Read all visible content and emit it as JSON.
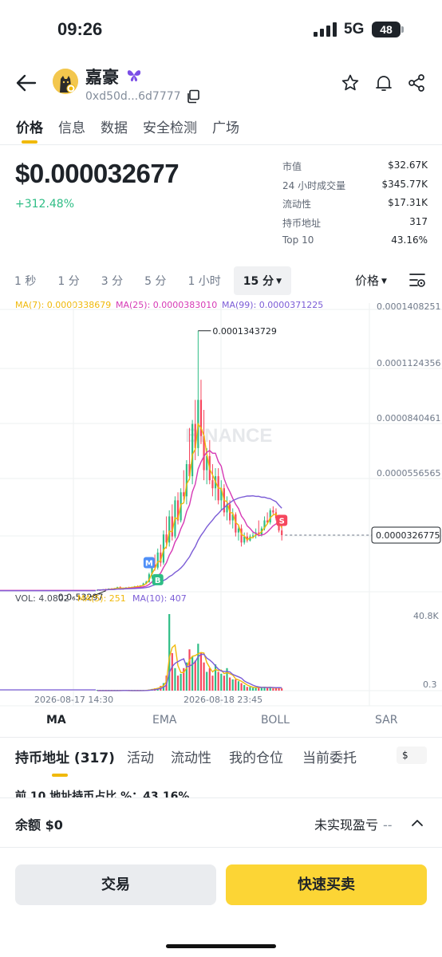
{
  "status_bar": {
    "time": "09:26",
    "network": "5G",
    "battery": "48"
  },
  "token": {
    "name": "嘉豪",
    "address": "0xd50d...6d7777"
  },
  "tabs": [
    "价格",
    "信息",
    "数据",
    "安全检测",
    "广场"
  ],
  "price": {
    "value": "$0.000032677",
    "change": "+312.48%"
  },
  "stats": [
    {
      "label": "市值",
      "value": "$32.67K"
    },
    {
      "label": "24 小时成交量",
      "value": "$345.77K"
    },
    {
      "label": "流动性",
      "value": "$17.31K"
    },
    {
      "label": "持币地址",
      "value": "317"
    },
    {
      "label": "Top 10",
      "value": "43.16%"
    }
  ],
  "intervals": [
    "1 秒",
    "1 分",
    "3 分",
    "5 分",
    "1 小时",
    "15 分"
  ],
  "price_selector": "价格",
  "ma_legend": {
    "ma7": "MA(7): 0.0000338679",
    "ma25": "MA(25): 0.0000383010",
    "ma99": "MA(99): 0.0000371225"
  },
  "vol_legend": {
    "vol": "VOL: 4.0802",
    "ma5": "MA(5): 251",
    "ma10": "MA(10): 407"
  },
  "watermark": "BINANCE",
  "colors": {
    "up": "#2ebd85",
    "down": "#f6465d",
    "ma7": "#f0b90b",
    "ma25": "#d63ab5",
    "ma99": "#7b5cd6",
    "accent": "#fcd535"
  },
  "chart_data": {
    "type": "candlestick",
    "title": "",
    "y_ticks": [
      "0.0001408251",
      "0.0001124356",
      "0.0000840461",
      "0.0000556565"
    ],
    "ylim": [
      4.5e-06,
      0.000145
    ],
    "current_price_label": "0.0000326775",
    "high_label": "0.0001343729",
    "low_label": "0.0₆53297",
    "volume_ticks": [
      "40.8K",
      "0.3"
    ],
    "x_ticks": [
      "2026-08-17 14:30",
      "2026-08-18 23:45"
    ],
    "markers": [
      "M",
      "B",
      "S"
    ],
    "candles": [
      {
        "o": 5e-06,
        "h": 5.6e-06,
        "l": 5e-06,
        "c": 5.4e-06,
        "v": 30
      },
      {
        "o": 5.4e-06,
        "h": 5.6e-06,
        "l": 5.2e-06,
        "c": 5.3e-06,
        "v": 20
      },
      {
        "o": 5.3e-06,
        "h": 5.8e-06,
        "l": 5.2e-06,
        "c": 5.6e-06,
        "v": 40
      },
      {
        "o": 5.6e-06,
        "h": 6e-06,
        "l": 5.5e-06,
        "c": 5.5e-06,
        "v": 30
      },
      {
        "o": 5.5e-06,
        "h": 6.2e-06,
        "l": 5.4e-06,
        "c": 6.1e-06,
        "v": 50
      },
      {
        "o": 6.1e-06,
        "h": 6.3e-06,
        "l": 5.7e-06,
        "c": 5.8e-06,
        "v": 40
      },
      {
        "o": 5.8e-06,
        "h": 6.4e-06,
        "l": 5.6e-06,
        "c": 6.2e-06,
        "v": 60
      },
      {
        "o": 6.2e-06,
        "h": 7e-06,
        "l": 6e-06,
        "c": 6.8e-06,
        "v": 80
      },
      {
        "o": 6.8e-06,
        "h": 7.2e-06,
        "l": 5.5e-06,
        "c": 5.9e-06,
        "v": 100
      },
      {
        "o": 5.9e-06,
        "h": 6.5e-06,
        "l": 5.6e-06,
        "c": 6.3e-06,
        "v": 60
      },
      {
        "o": 6.3e-06,
        "h": 6.8e-06,
        "l": 6e-06,
        "c": 6.6e-06,
        "v": 50
      },
      {
        "o": 6.6e-06,
        "h": 7e-06,
        "l": 6.2e-06,
        "c": 6.4e-06,
        "v": 40
      },
      {
        "o": 6.4e-06,
        "h": 7e-06,
        "l": 6.2e-06,
        "c": 6.9e-06,
        "v": 50
      },
      {
        "o": 6.9e-06,
        "h": 7.4e-06,
        "l": 6.6e-06,
        "c": 7.2e-06,
        "v": 60
      },
      {
        "o": 7.2e-06,
        "h": 7.6e-06,
        "l": 6.8e-06,
        "c": 7e-06,
        "v": 40
      },
      {
        "o": 7e-06,
        "h": 7.8e-06,
        "l": 6.9e-06,
        "c": 7.6e-06,
        "v": 60
      },
      {
        "o": 7.6e-06,
        "h": 9e-06,
        "l": 7.4e-06,
        "c": 8.6e-06,
        "v": 120
      },
      {
        "o": 8.6e-06,
        "h": 1e-05,
        "l": 8.2e-06,
        "c": 9.4e-06,
        "v": 200
      },
      {
        "o": 9.4e-06,
        "h": 1.4e-05,
        "l": 9e-06,
        "c": 1.32e-05,
        "v": 600
      },
      {
        "o": 1.32e-05,
        "h": 2e-05,
        "l": 1.1e-05,
        "c": 1.8e-05,
        "v": 900
      },
      {
        "o": 1.8e-05,
        "h": 2.3e-05,
        "l": 1.5e-05,
        "c": 1.65e-05,
        "v": 1200
      },
      {
        "o": 1.65e-05,
        "h": 2.6e-05,
        "l": 1.55e-05,
        "c": 2.4e-05,
        "v": 1500
      },
      {
        "o": 2.4e-05,
        "h": 2.8e-05,
        "l": 1.7e-05,
        "c": 1.9e-05,
        "v": 2500
      },
      {
        "o": 1.9e-05,
        "h": 3.5e-05,
        "l": 1.8e-05,
        "c": 3.3e-05,
        "v": 4000
      },
      {
        "o": 3.3e-05,
        "h": 4.2e-05,
        "l": 2.6e-05,
        "c": 2.9e-05,
        "v": 8000
      },
      {
        "o": 2.9e-05,
        "h": 4.5e-05,
        "l": 2.7e-05,
        "c": 4.2e-05,
        "v": 40800
      },
      {
        "o": 4.2e-05,
        "h": 4.8e-05,
        "l": 3e-05,
        "c": 3.2e-05,
        "v": 20000
      },
      {
        "o": 3.2e-05,
        "h": 5.2e-05,
        "l": 3.1e-05,
        "c": 5e-05,
        "v": 12000
      },
      {
        "o": 5e-05,
        "h": 5.4e-05,
        "l": 3.8e-05,
        "c": 4e-05,
        "v": 8000
      },
      {
        "o": 4e-05,
        "h": 5.6e-05,
        "l": 3.9e-05,
        "c": 5.4e-05,
        "v": 9000
      },
      {
        "o": 5.4e-05,
        "h": 6.5e-05,
        "l": 5e-05,
        "c": 5.2e-05,
        "v": 12000
      },
      {
        "o": 5.2e-05,
        "h": 7e-05,
        "l": 4.8e-05,
        "c": 6.8e-05,
        "v": 15000
      },
      {
        "o": 6.8e-05,
        "h": 8.6e-05,
        "l": 6e-05,
        "c": 6.2e-05,
        "v": 22000
      },
      {
        "o": 6.2e-05,
        "h": 9e-05,
        "l": 5.8e-05,
        "c": 8.8e-05,
        "v": 18000
      },
      {
        "o": 8.8e-05,
        "h": 0.0001,
        "l": 7e-05,
        "c": 7.6e-05,
        "v": 16000
      },
      {
        "o": 7.6e-05,
        "h": 0.0001343729,
        "l": 7.2e-05,
        "c": 0.0001,
        "v": 25000
      },
      {
        "o": 0.0001,
        "h": 0.00011,
        "l": 7.8e-05,
        "c": 8.2e-05,
        "v": 20000
      },
      {
        "o": 8.2e-05,
        "h": 9.5e-05,
        "l": 6e-05,
        "c": 6.5e-05,
        "v": 15000
      },
      {
        "o": 6.5e-05,
        "h": 7.6e-05,
        "l": 5.8e-05,
        "c": 7.2e-05,
        "v": 10000
      },
      {
        "o": 7.2e-05,
        "h": 8e-05,
        "l": 5.8e-05,
        "c": 6e-05,
        "v": 12000
      },
      {
        "o": 6e-05,
        "h": 6.8e-05,
        "l": 5.2e-05,
        "c": 5.6e-05,
        "v": 8000
      },
      {
        "o": 5.6e-05,
        "h": 6.6e-05,
        "l": 5e-05,
        "c": 6.2e-05,
        "v": 14000
      },
      {
        "o": 6.2e-05,
        "h": 6.6e-05,
        "l": 4.8e-05,
        "c": 5e-05,
        "v": 10000
      },
      {
        "o": 5e-05,
        "h": 6e-05,
        "l": 4.5e-05,
        "c": 5.6e-05,
        "v": 9000
      },
      {
        "o": 5.6e-05,
        "h": 5.8e-05,
        "l": 4.2e-05,
        "c": 4.4e-05,
        "v": 8000
      },
      {
        "o": 4.4e-05,
        "h": 5.2e-05,
        "l": 4e-05,
        "c": 4.8e-05,
        "v": 12000
      },
      {
        "o": 4.8e-05,
        "h": 5e-05,
        "l": 3.8e-05,
        "c": 4e-05,
        "v": 7000
      },
      {
        "o": 4e-05,
        "h": 4.6e-05,
        "l": 3.6e-05,
        "c": 4.3e-05,
        "v": 6000
      },
      {
        "o": 4.3e-05,
        "h": 4.4e-05,
        "l": 3.2e-05,
        "c": 3.4e-05,
        "v": 6000
      },
      {
        "o": 3.4e-05,
        "h": 3.8e-05,
        "l": 3e-05,
        "c": 3.6e-05,
        "v": 5000
      },
      {
        "o": 3.6e-05,
        "h": 3.8e-05,
        "l": 2.7e-05,
        "c": 2.9e-05,
        "v": 4000
      },
      {
        "o": 2.9e-05,
        "h": 3.4e-05,
        "l": 2.8e-05,
        "c": 3.2e-05,
        "v": 3000
      },
      {
        "o": 3.2e-05,
        "h": 3.4e-05,
        "l": 2.9e-05,
        "c": 3e-05,
        "v": 2000
      },
      {
        "o": 3e-05,
        "h": 3.3e-05,
        "l": 2.95e-05,
        "c": 3.2e-05,
        "v": 2000
      },
      {
        "o": 3.2e-05,
        "h": 3.4e-05,
        "l": 3.1e-05,
        "c": 3.25e-05,
        "v": 1500
      },
      {
        "o": 3.25e-05,
        "h": 3.6e-05,
        "l": 3.1e-05,
        "c": 3.4e-05,
        "v": 1500
      },
      {
        "o": 3.4e-05,
        "h": 4e-05,
        "l": 3.2e-05,
        "c": 3.3e-05,
        "v": 2000
      },
      {
        "o": 3.3e-05,
        "h": 3.7e-05,
        "l": 3.2e-05,
        "c": 3.6e-05,
        "v": 1500
      },
      {
        "o": 3.6e-05,
        "h": 4.2e-05,
        "l": 3.5e-05,
        "c": 4e-05,
        "v": 2000
      },
      {
        "o": 4e-05,
        "h": 4.4e-05,
        "l": 3.8e-05,
        "c": 3.9e-05,
        "v": 1500
      },
      {
        "o": 3.9e-05,
        "h": 4.6e-05,
        "l": 3.8e-05,
        "c": 4.5e-05,
        "v": 1800
      },
      {
        "o": 4.5e-05,
        "h": 4.7e-05,
        "l": 4.3e-05,
        "c": 4.4e-05,
        "v": 1200
      },
      {
        "o": 4.4e-05,
        "h": 4.6e-05,
        "l": 4e-05,
        "c": 4.1e-05,
        "v": 1500
      },
      {
        "o": 4.1e-05,
        "h": 4.2e-05,
        "l": 3.4e-05,
        "c": 3.5e-05,
        "v": 1800
      },
      {
        "o": 3.5e-05,
        "h": 3.8e-05,
        "l": 3e-05,
        "c": 3.26775e-05,
        "v": 1200
      }
    ]
  },
  "indicator_tabs": [
    "MA",
    "EMA",
    "BOLL",
    "SAR"
  ],
  "sub_tabs": [
    "持币地址 (317)",
    "活动",
    "流动性",
    "我的仓位",
    "当前委托"
  ],
  "currency": "$",
  "top10_text": "前 10 地址持币占比 %：43.16%",
  "bottom": {
    "balance": "余额 $0",
    "pnl_label": "未实现盈亏",
    "pnl_value": "--",
    "trade_button": "交易",
    "quick_button": "快速买卖"
  }
}
